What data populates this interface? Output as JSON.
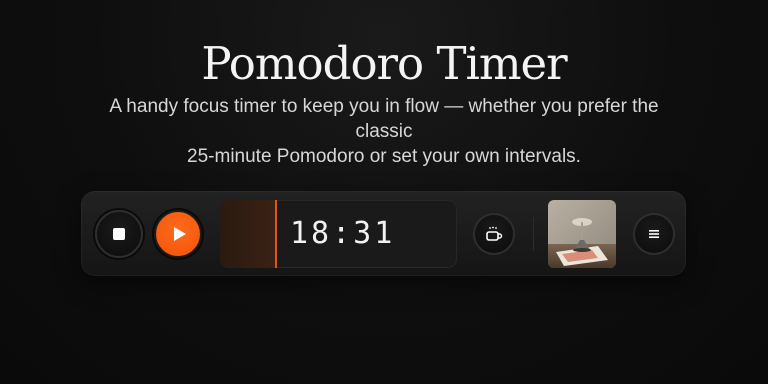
{
  "header": {
    "title": "Pomodoro Timer",
    "subtitle_line1": "A handy focus timer to keep you in flow — whether you prefer the classic",
    "subtitle_line2": "25-minute Pomodoro or set your own intervals."
  },
  "timer": {
    "time": "18:31",
    "progress_fraction": 0.23,
    "accent_color": "#f0540a",
    "progress_color": "#e0561a"
  },
  "controls": {
    "stop_icon": "stop-icon",
    "play_icon": "play-icon",
    "break_icon": "coffee-cup-icon",
    "menu_icon": "menu-icon"
  },
  "thumbnail": {
    "subject": "desk-lamp-photo"
  }
}
